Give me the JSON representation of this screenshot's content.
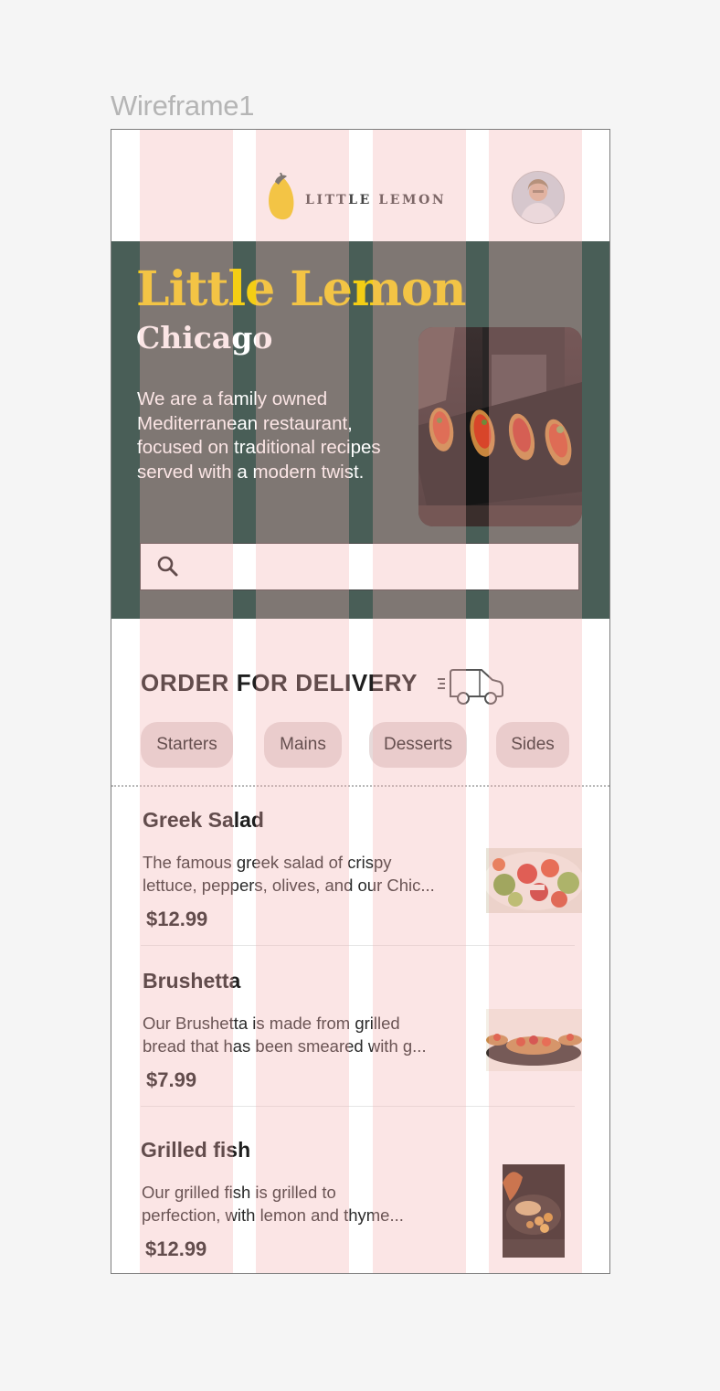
{
  "canvas": {
    "frame_label": "Wireframe1"
  },
  "header": {
    "logo_text": "LITTLE LEMON",
    "avatar_icon": "user-avatar"
  },
  "hero": {
    "title": "Little Lemon",
    "city": "Chicago",
    "description": "We are a family owned Mediterranean restaurant, focused on traditional recipes served with a modern twist.",
    "search": {
      "placeholder": "",
      "icon": "search-icon"
    }
  },
  "delivery": {
    "title": "ORDER FOR DELIVERY",
    "icon": "delivery-truck-icon",
    "categories": [
      "Starters",
      "Mains",
      "Desserts",
      "Sides"
    ]
  },
  "menu": {
    "items": [
      {
        "name": "Greek Salad",
        "desc_line1": "The famous greek salad of crispy",
        "desc_line2": "lettuce, peppers, olives, and our Chic...",
        "price": "$12.99"
      },
      {
        "name": "Brushetta",
        "desc_line1": "Our Brushetta is made from grilled",
        "desc_line2": "bread that has been smeared with g...",
        "price": "$7.99"
      },
      {
        "name": "Grilled fish",
        "desc_line1": "Our grilled fish is grilled to",
        "desc_line2": "perfection, with lemon and thyme...",
        "price": "$12.99"
      }
    ]
  },
  "colors": {
    "brand_green": "#495e57",
    "brand_yellow": "#f4ce14",
    "chip_bg": "#e6dada",
    "grid_overlay": "#f3aeae"
  }
}
